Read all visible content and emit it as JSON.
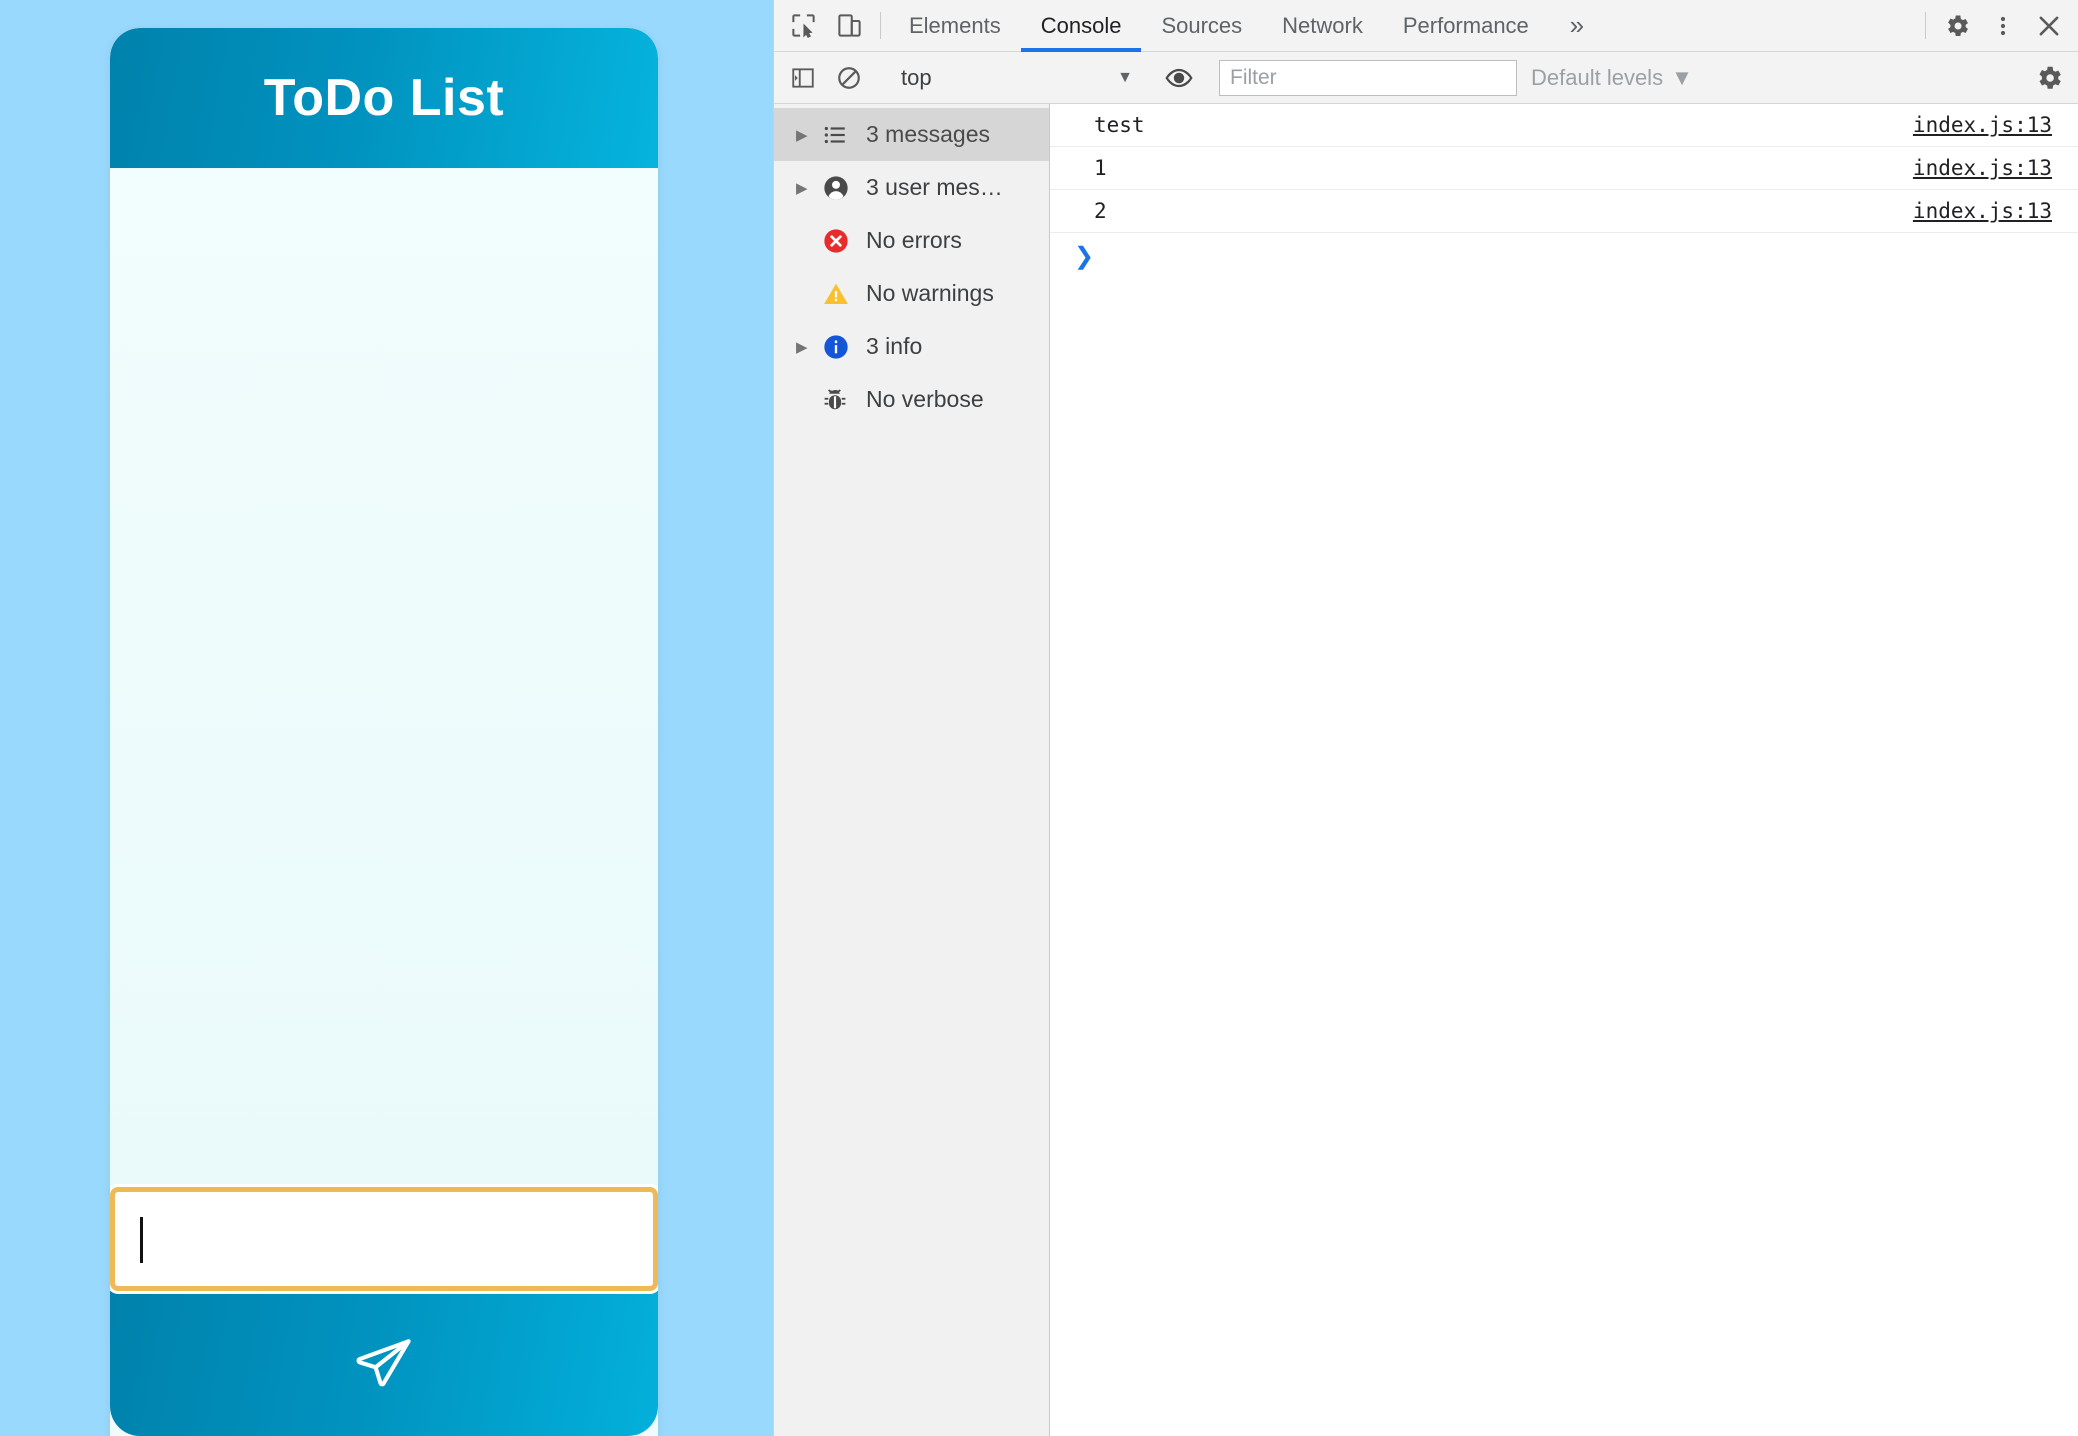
{
  "app": {
    "title": "ToDo List",
    "input_placeholder": "",
    "input_value": "",
    "submit_icon": "send-paper-plane-icon",
    "colors": {
      "page_background": "#99d9fd",
      "card_background": "#effbfc",
      "header_gradient_start": "#0082ac",
      "header_gradient_end": "#05b4dd",
      "input_focus_border": "#eeba56"
    },
    "todo_items": []
  },
  "devtools": {
    "toolbar": {
      "inspect_icon": "inspect-element-icon",
      "device_icon": "device-toolbar-icon",
      "overflow_label": "»",
      "settings_icon": "gear-icon",
      "menu_icon": "three-dots-menu-icon",
      "close_icon": "close-icon"
    },
    "tabs": [
      {
        "label": "Elements",
        "active": false
      },
      {
        "label": "Console",
        "active": true
      },
      {
        "label": "Sources",
        "active": false
      },
      {
        "label": "Network",
        "active": false
      },
      {
        "label": "Performance",
        "active": false
      }
    ],
    "console_toolbar": {
      "sidebar_toggle_icon": "show-console-sidebar-icon",
      "clear_icon": "clear-console-icon",
      "context": "top",
      "context_caret": "▼",
      "eye_icon": "create-live-expression-icon",
      "filter_placeholder": "Filter",
      "filter_value": "",
      "levels_label": "Default levels",
      "levels_caret": "▼",
      "settings_icon": "gear-icon"
    },
    "sidebar": [
      {
        "label": "3 messages",
        "icon": "list-icon",
        "twisty": true,
        "selected": true
      },
      {
        "label": "3 user mes…",
        "icon": "user-icon",
        "twisty": true,
        "selected": false
      },
      {
        "label": "No errors",
        "icon": "error-icon",
        "twisty": false,
        "selected": false
      },
      {
        "label": "No warnings",
        "icon": "warning-icon",
        "twisty": false,
        "selected": false
      },
      {
        "label": "3 info",
        "icon": "info-icon",
        "twisty": true,
        "selected": false
      },
      {
        "label": "No verbose",
        "icon": "bug-icon",
        "twisty": false,
        "selected": false
      }
    ],
    "messages": [
      {
        "text": "test",
        "source": "index.js:13"
      },
      {
        "text": "1",
        "source": "index.js:13"
      },
      {
        "text": "2",
        "source": "index.js:13"
      }
    ],
    "prompt_symbol": "❯"
  }
}
